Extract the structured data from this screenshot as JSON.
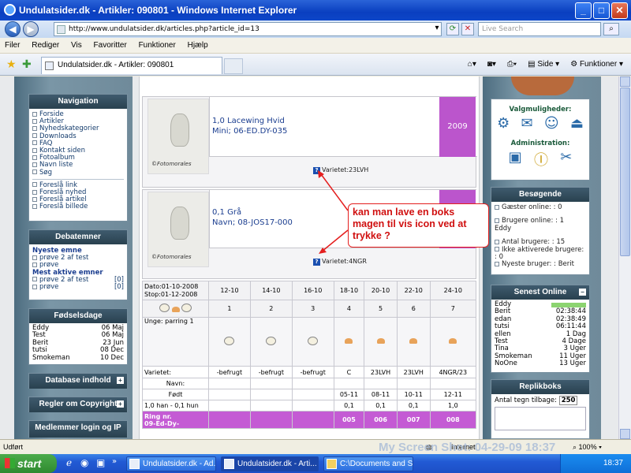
{
  "window": {
    "title": "Undulatsider.dk - Artikler: 090801 - Windows Internet Explorer",
    "min": "_",
    "max": "□",
    "close": "✕"
  },
  "address": {
    "url": "http://www.undulatsider.dk/articles.php?article_id=13",
    "search_placeholder": "Live Search"
  },
  "menu": [
    "Filer",
    "Rediger",
    "Vis",
    "Favoritter",
    "Funktioner",
    "Hjælp"
  ],
  "tab": {
    "title": "Undulatsider.dk - Artikler: 090801"
  },
  "tools": {
    "page": "Side",
    "functions": "Funktioner"
  },
  "left": {
    "navigation": {
      "title": "Navigation",
      "items": [
        "Forside",
        "Artikler",
        "Nyhedskategorier",
        "Downloads",
        "FAQ",
        "Kontakt siden",
        "Fotoalbum",
        "Navn liste",
        "Søg"
      ],
      "items2": [
        "Foreslå link",
        "Foreslå nyhed",
        "Foreslå artikel",
        "Foreslå billede"
      ]
    },
    "debat": {
      "title": "Debatemner",
      "newest_label": "Nyeste emne",
      "newest": [
        "prøve 2 af test",
        "prøve"
      ],
      "active_label": "Mest aktive emner",
      "active": [
        {
          "t": "prøve 2 af test",
          "n": "[0]"
        },
        {
          "t": "prøve",
          "n": "[0]"
        }
      ]
    },
    "birthdays": {
      "title": "Fødselsdage",
      "rows": [
        {
          "n": "Eddy",
          "d": "06 Maj"
        },
        {
          "n": "Test",
          "d": "06 Maj"
        },
        {
          "n": "Berit",
          "d": "23 Jun"
        },
        {
          "n": "tutsi",
          "d": "08 Dec"
        },
        {
          "n": "Smokeman",
          "d": "10 Dec"
        }
      ]
    },
    "database": "Database indhold",
    "rules": "Regler om Copyright",
    "members": "Medlemmer login og IP"
  },
  "main": {
    "card1": {
      "line1": "1,0 Lacewing Hvid",
      "line2": "Mini; 06-ED.DY-035",
      "year": "2009",
      "variety": "Varietet:23LVH"
    },
    "card2": {
      "line1": "0,1 Grå",
      "line2": "Navn; 08-JOS17-000",
      "variety": "Varietet:4NGR"
    },
    "photo_logo": "©Fotomorales",
    "table": {
      "date_start": "Dato:01-10-2008",
      "date_stop": "Stop:01-12-2008",
      "dates": [
        "12-10",
        "14-10",
        "16-10",
        "18-10",
        "20-10",
        "22-10",
        "24-10"
      ],
      "nums": [
        "1",
        "2",
        "3",
        "4",
        "5",
        "6",
        "7"
      ],
      "unge": "Unge: parring 1",
      "row_var_label": "Varietet:",
      "row_var": [
        "-befrugt",
        "-befrugt",
        "-befrugt",
        "C",
        "23LVH",
        "23LVH",
        "4NGR/23"
      ],
      "row_navn_label": "Navn:",
      "row_fodt_label": "Født",
      "row_fodt": [
        "",
        "",
        "",
        "05-11",
        "08-11",
        "10-11",
        "12-11"
      ],
      "row_sex_label": "1,0 han - 0,1 hun",
      "row_sex": [
        "",
        "",
        "",
        "0,1",
        "0,1",
        "0,1",
        "1,0"
      ],
      "ring_label1": "Ring nr.",
      "ring_label2": "09-Ed-Dy-",
      "ring": [
        "",
        "",
        "",
        "005",
        "006",
        "007",
        "008"
      ]
    }
  },
  "annotation": "kan man lave en boks magen til vis icon ved at trykke ?",
  "right": {
    "options_title": "Valgmuligheder:",
    "admin_title": "Administration:",
    "visitors": {
      "title": "Besøgende",
      "guests": "Gæster online: : 0",
      "users": "Brugere online: : 1",
      "user_name": "Eddy",
      "count": "Antal brugere: : 15",
      "inactive": "Ikke aktiverede brugere: : 0",
      "newest": "Nyeste bruger: : Berit"
    },
    "online": {
      "title": "Senest Online",
      "rows": [
        {
          "n": "Eddy",
          "t": ""
        },
        {
          "n": "Berit",
          "t": "02:38:44"
        },
        {
          "n": "edan",
          "t": "02:38:49"
        },
        {
          "n": "tutsi",
          "t": "06:11:44"
        },
        {
          "n": "ellen",
          "t": "1 Dag"
        },
        {
          "n": "Test",
          "t": "4 Dage"
        },
        {
          "n": "Tina",
          "t": "3 Uger"
        },
        {
          "n": "Smokeman",
          "t": "11 Uger"
        },
        {
          "n": "NoOne",
          "t": "13 Uger"
        }
      ]
    },
    "replik": {
      "title": "Replikboks",
      "label": "Antal tegn tilbage:",
      "count": "250"
    }
  },
  "status": {
    "left": "Udført",
    "zone": "Internet",
    "zoom": "100%"
  },
  "watermark": "My Screen Shot: 04-29-09 18:37",
  "taskbar": {
    "start": "start",
    "tasks": [
      "Undulatsider.dk - Ad...",
      "Undulatsider.dk - Arti...",
      "C:\\Documents and Se..."
    ],
    "clock": "18:37"
  }
}
